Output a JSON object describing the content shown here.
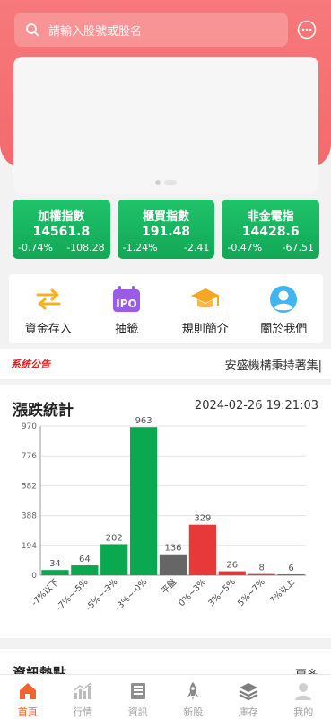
{
  "search": {
    "placeholder": "請輸入股號或股名"
  },
  "indices": [
    {
      "name": "加權指數",
      "value": "14561.8",
      "pct": "-0.74%",
      "change": "-108.28"
    },
    {
      "name": "櫃買指數",
      "value": "191.48",
      "pct": "-1.24%",
      "change": "-2.41"
    },
    {
      "name": "非金電指",
      "value": "14428.6",
      "pct": "-0.47%",
      "change": "-67.51"
    }
  ],
  "shortcuts": [
    {
      "label": "資金存入",
      "icon": "transfer-arrows-icon"
    },
    {
      "label": "抽籤",
      "icon": "ipo-calendar-icon"
    },
    {
      "label": "規則簡介",
      "icon": "graduation-cap-icon"
    },
    {
      "label": "關於我們",
      "icon": "user-circle-icon"
    }
  ],
  "notice": {
    "tag": "系统公告",
    "text": "安盛機構秉持著集|"
  },
  "stats": {
    "title": "漲跌統計",
    "time": "2024-02-26 19:21:03"
  },
  "chart_data": {
    "type": "bar",
    "categories": [
      "-7%以下",
      "-7%~-5%",
      "-5%~-3%",
      "-3%~-0%",
      "平盤",
      "0%~3%",
      "3%~5%",
      "5%~7%",
      "7%以上"
    ],
    "values": [
      34,
      64,
      202,
      963,
      136,
      329,
      26,
      8,
      6
    ],
    "colors": [
      "#0aa84f",
      "#0aa84f",
      "#0aa84f",
      "#0aa84f",
      "#666666",
      "#e8393a",
      "#e8393a",
      "#e8393a",
      "#e8393a"
    ],
    "yticks": [
      0,
      194,
      388,
      582,
      776,
      970
    ],
    "ylim": [
      0,
      970
    ],
    "grid": true
  },
  "news": {
    "title": "資訊熱點",
    "more": "更多"
  },
  "tabs": [
    {
      "label": "首頁",
      "icon": "home-icon",
      "active": true
    },
    {
      "label": "行情",
      "icon": "market-chart-icon",
      "active": false
    },
    {
      "label": "資訊",
      "icon": "news-icon",
      "active": false
    },
    {
      "label": "新股",
      "icon": "rocket-icon",
      "active": false
    },
    {
      "label": "庫存",
      "icon": "layers-icon",
      "active": false
    },
    {
      "label": "我的",
      "icon": "profile-icon",
      "active": false
    }
  ],
  "colors": {
    "brand": "#f36a6d",
    "up": "#e8393a",
    "down": "#0aa84f",
    "tab_active": "#f0642e"
  }
}
